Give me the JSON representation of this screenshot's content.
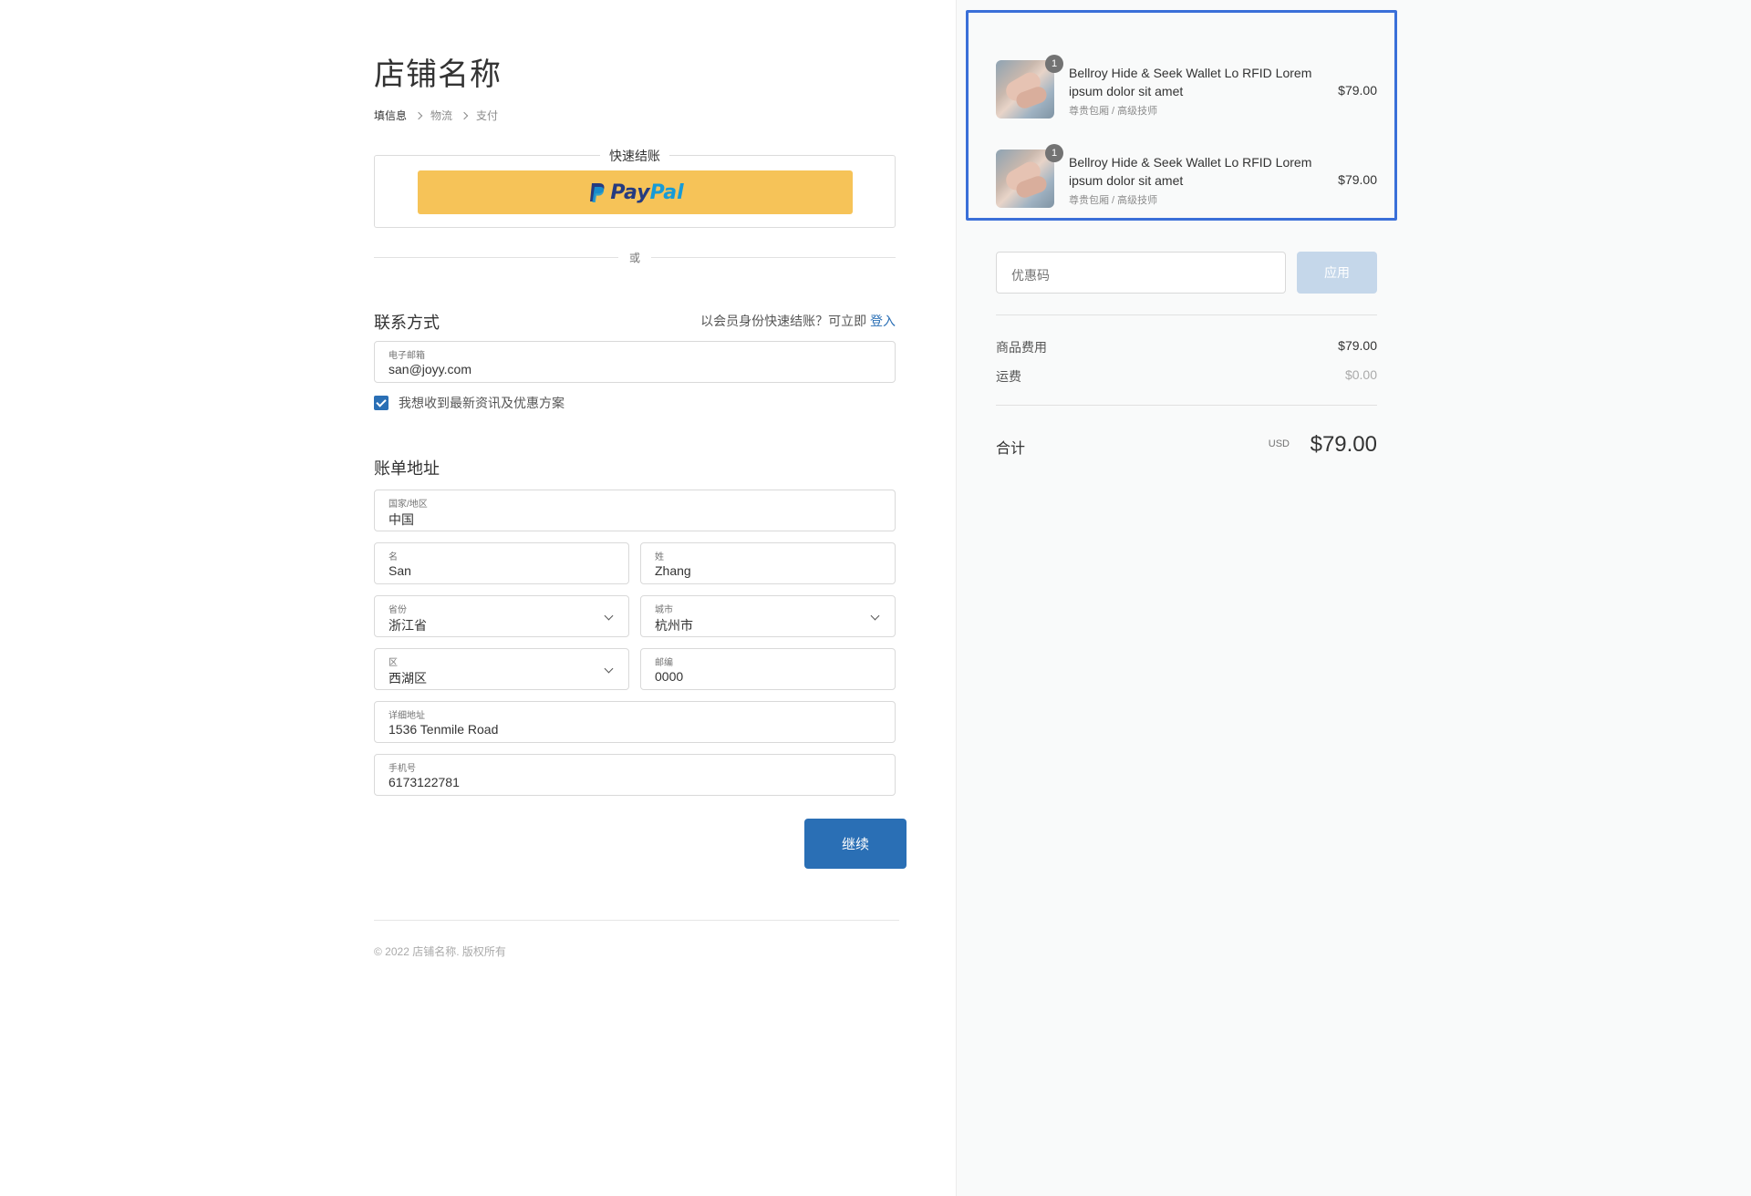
{
  "store": {
    "title": "店铺名称"
  },
  "breadcrumb": [
    "填信息",
    "物流",
    "支付"
  ],
  "express": {
    "legend": "快速结账",
    "paypal_pay": "Pay",
    "paypal_pal": "Pal"
  },
  "divider": {
    "or": "或"
  },
  "contact": {
    "title": "联系方式",
    "login_hint": "以会员身份快速结账？可立即",
    "login_link": "登入",
    "email_label": "电子邮箱",
    "email_value": "san@joyy.com",
    "newsletter_label": "我想收到最新资讯及优惠方案",
    "newsletter_checked": true
  },
  "billing": {
    "title": "账单地址",
    "country_label": "国家/地区",
    "country_value": "中国",
    "first_name_label": "名",
    "first_name_value": "San",
    "last_name_label": "姓",
    "last_name_value": "Zhang",
    "province_label": "省份",
    "province_value": "浙江省",
    "city_label": "城市",
    "city_value": "杭州市",
    "district_label": "区",
    "district_value": "西湖区",
    "zip_label": "邮编",
    "zip_value": "0000",
    "address_label": "详细地址",
    "address_value": "1536 Tenmile Road",
    "phone_label": "手机号",
    "phone_value": "6173122781"
  },
  "actions": {
    "continue_label": "继续"
  },
  "footer": {
    "copyright": "© 2022 店铺名称. 版权所有"
  },
  "cart": {
    "items": [
      {
        "quantity": "1",
        "name": "Bellroy Hide & Seek Wallet Lo RFID Lorem ipsum dolor sit amet",
        "variant": "尊贵包厢 / 高级技师",
        "price": "$79.00"
      },
      {
        "quantity": "1",
        "name": "Bellroy Hide & Seek Wallet Lo RFID Lorem ipsum dolor sit amet",
        "variant": "尊贵包厢 / 高级技师",
        "price": "$79.00"
      }
    ]
  },
  "coupon": {
    "placeholder": "优惠码",
    "apply_label": "应用"
  },
  "summary": {
    "subtotal_label": "商品费用",
    "subtotal_value": "$79.00",
    "shipping_label": "运费",
    "shipping_value": "$0.00",
    "total_label": "合计",
    "currency": "USD",
    "total_value": "$79.00"
  },
  "colors": {
    "accent": "#2a6fb5",
    "paypal": "#f6c358",
    "highlight": "#3a6fd8"
  }
}
